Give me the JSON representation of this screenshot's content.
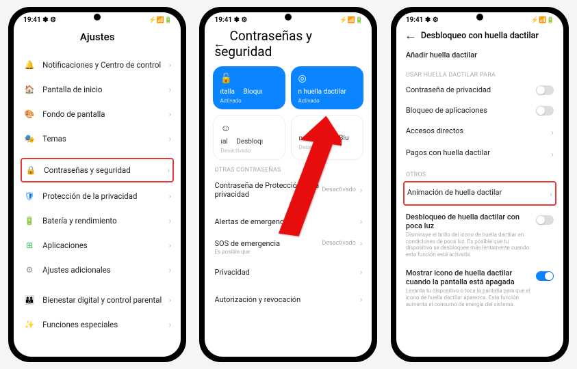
{
  "statusbar": {
    "time": "19:41",
    "icons": "✽ ⚙",
    "right": "⚡ 📶 🔋"
  },
  "screen1": {
    "title": "Ajustes",
    "items": [
      {
        "icon": "🔔",
        "iconClass": "ic-orange",
        "label": "Notificaciones y Centro de control"
      },
      {
        "icon": "🏠",
        "iconClass": "ic-yellow",
        "label": "Pantalla de inicio"
      },
      {
        "icon": "🎨",
        "iconClass": "ic-red",
        "label": "Fondo de pantalla"
      },
      {
        "icon": "🎭",
        "iconClass": "ic-teal",
        "label": "Temas"
      }
    ],
    "highlighted": {
      "icon": "🔒",
      "iconClass": "ic-blue",
      "label": "Contraseñas y seguridad"
    },
    "items2": [
      {
        "icon": "🛡",
        "iconClass": "ic-blue",
        "label": "Protección de la privacidad"
      },
      {
        "icon": "🔋",
        "iconClass": "ic-green",
        "label": "Batería y rendimiento"
      },
      {
        "icon": "⊞",
        "iconClass": "ic-green",
        "label": "Aplicaciones"
      },
      {
        "icon": "⚙",
        "iconClass": "ic-gray",
        "label": "Ajustes adicionales"
      }
    ],
    "items3": [
      {
        "icon": "👪",
        "iconClass": "ic-green",
        "label": "Bienestar digital y control parental"
      },
      {
        "icon": "✨",
        "iconClass": "ic-purple",
        "label": "Funciones especiales"
      }
    ]
  },
  "screen2": {
    "title": "Contraseñas y seguridad",
    "cards": [
      {
        "icon": "🔓",
        "t1": "ıtalla",
        "t2": "Bloquı",
        "status": "Activado"
      },
      {
        "icon": "◎",
        "t1": "n huella dactilar",
        "status": "Activado"
      }
    ],
    "cards2": [
      {
        "icon": "☺",
        "t1": "ıal",
        "t2": "Desbloqı",
        "status": "Desactivado"
      },
      {
        "t1": "n dispositivo Blu",
        "status": "Desactivado"
      }
    ],
    "section1": "OTRAS CONTRASEÑAS",
    "rows1": [
      {
        "label": "Contraseña de Protección de la privacidad",
        "status": "Desactivado"
      }
    ],
    "rows2": [
      {
        "label": "Alertas de emergencias"
      },
      {
        "label": "SOS de emergencia",
        "sub": "Es posible que",
        "status": "Desactivado"
      },
      {
        "label": "Privacidad"
      }
    ],
    "rows3": [
      {
        "label": "Autorización y revocación"
      }
    ]
  },
  "screen3": {
    "title": "Desbloqueo con huella dactilar",
    "add": "Añadir huella dactilar",
    "section1": "USAR HUELLA DACTILAR PARA",
    "toggles": [
      {
        "label": "Contraseña de privacidad",
        "on": false
      },
      {
        "label": "Bloqueo de aplicaciones",
        "on": false
      }
    ],
    "links": [
      {
        "label": "Accesos directos"
      },
      {
        "label": "Pagos con huella dactilar"
      }
    ],
    "section2": "OTROS",
    "highlighted": {
      "label": "Animación de huella dactilar"
    },
    "others": [
      {
        "label": "Desbloqueo de huella dactilar con poca luz",
        "desc": "Disminuye el brillo del icono de huella dactilar en condiciones de poca luz. Es posible que tu dispositivo se desbloquee más lentamente cuando esta función está activada.",
        "on": false
      },
      {
        "label": "Mostrar icono de huella dactilar cuando la pantalla está apagada",
        "desc": "Levanta tu dispositivo o toca la pantalla para que el icono de huella dactilar aparezca. Esta función aumenta el consumo de energía del sistema.",
        "on": true
      }
    ]
  }
}
